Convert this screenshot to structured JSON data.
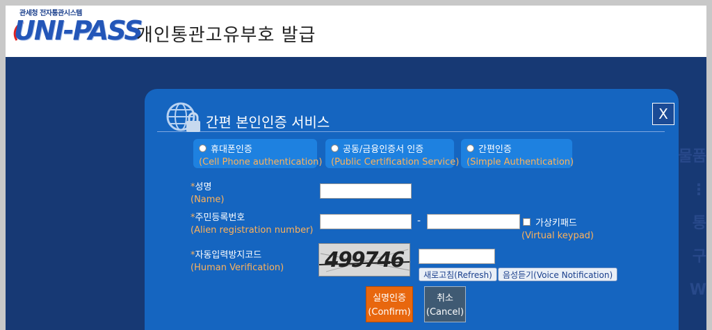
{
  "header": {
    "logo_small_text": "관세청 전자통관시스템",
    "logo_main_text": "UNI-PASS",
    "page_title": "개인통관고유부호 발급"
  },
  "backdrop": {
    "side_text": [
      "물품",
      "⋮",
      "통",
      "구",
      "W"
    ]
  },
  "dialog": {
    "title": "간편 본인인증 서비스",
    "close_label": "X",
    "auth_tabs": [
      {
        "label": "휴대폰인증",
        "sub": "(Cell Phone authentication)"
      },
      {
        "label": "공동/금융인증서 인증",
        "sub": "(Public Certification Service)"
      },
      {
        "label": "간편인증",
        "sub": "(Simple Authentication)"
      }
    ],
    "fields": {
      "name": {
        "star": "*",
        "label": "성명",
        "sub": "(Name)",
        "value": ""
      },
      "reg_number": {
        "star": "*",
        "label": "주민등록번호",
        "sub": "(Alien registration number)",
        "first_value": "",
        "second_value": "",
        "separator": "-"
      },
      "virtual_keypad": {
        "label": "가상키패드",
        "sub": "(Virtual keypad)"
      },
      "captcha": {
        "star": "*",
        "label": "자동입력방지코드",
        "sub": "(Human Verification)",
        "code_image_text": "499746",
        "value": "",
        "refresh_label": "새로고침(Refresh)",
        "voice_label": "음성듣기(Voice Notification)"
      }
    },
    "confirm_button": {
      "label": "실명인증",
      "sub": "(Confirm)"
    },
    "cancel_button": {
      "label": "취소",
      "sub": "(Cancel)"
    }
  },
  "colors": {
    "backdrop": "#173974",
    "dialog": "#1565c0",
    "tab": "#1e81e0",
    "accent_orange": "#ffb25a",
    "confirm": "#e8670e",
    "cancel": "#3f5a73"
  }
}
